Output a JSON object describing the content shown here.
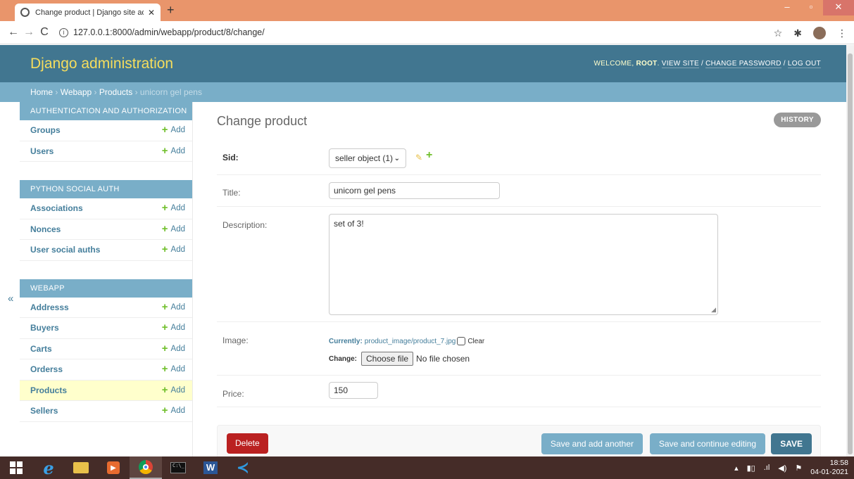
{
  "browser": {
    "tab_title": "Change product | Django site ad",
    "tab_close": "✕",
    "new_tab": "+",
    "url": "127.0.0.1:8000/admin/webapp/product/8/change/",
    "win_minimize": "–",
    "win_restore": "▫",
    "win_close": "✕"
  },
  "header": {
    "brand": "Django administration",
    "welcome": "Welcome,",
    "user": "root",
    "view_site": "View site",
    "change_password": "Change password",
    "log_out": "Log out"
  },
  "breadcrumbs": {
    "home": "Home",
    "app": "Webapp",
    "model": "Products",
    "current": "unicorn gel pens",
    "sep": "›"
  },
  "sidebar": {
    "collapse": "«",
    "add_label": "Add",
    "groups": [
      {
        "caption": "Authentication and Authorization",
        "items": [
          {
            "label": "Groups"
          },
          {
            "label": "Users"
          }
        ]
      },
      {
        "caption": "Python Social Auth",
        "items": [
          {
            "label": "Associations"
          },
          {
            "label": "Nonces"
          },
          {
            "label": "User social auths"
          }
        ]
      },
      {
        "caption": "Webapp",
        "items": [
          {
            "label": "Addresss"
          },
          {
            "label": "Buyers"
          },
          {
            "label": "Carts"
          },
          {
            "label": "Orderss"
          },
          {
            "label": "Products",
            "current": true
          },
          {
            "label": "Sellers"
          }
        ]
      }
    ]
  },
  "form": {
    "title": "Change product",
    "history": "History",
    "sid": {
      "label": "Sid:",
      "value": "seller object (1)"
    },
    "title_field": {
      "label": "Title:",
      "value": "unicorn gel pens"
    },
    "description": {
      "label": "Description:",
      "value": "set of 3!"
    },
    "image": {
      "label": "Image:",
      "currently_label": "Currently:",
      "current_file": "product_image/product_7.jpg",
      "clear_label": "Clear",
      "change_label": "Change:",
      "choose_button": "Choose file",
      "no_file": "No file chosen"
    },
    "price": {
      "label": "Price:",
      "value": "150"
    }
  },
  "submit": {
    "delete": "Delete",
    "save_add_another": "Save and add another",
    "save_continue": "Save and continue editing",
    "save": "SAVE"
  },
  "taskbar": {
    "time": "18:58",
    "date": "04-01-2021"
  },
  "colors": {
    "header": "#417690",
    "breadcrumbs": "#79aec8",
    "brand": "#f5dd5d",
    "delete": "#ba2121",
    "add_plus": "#70bf2b",
    "current_row": "#ffffcc"
  }
}
